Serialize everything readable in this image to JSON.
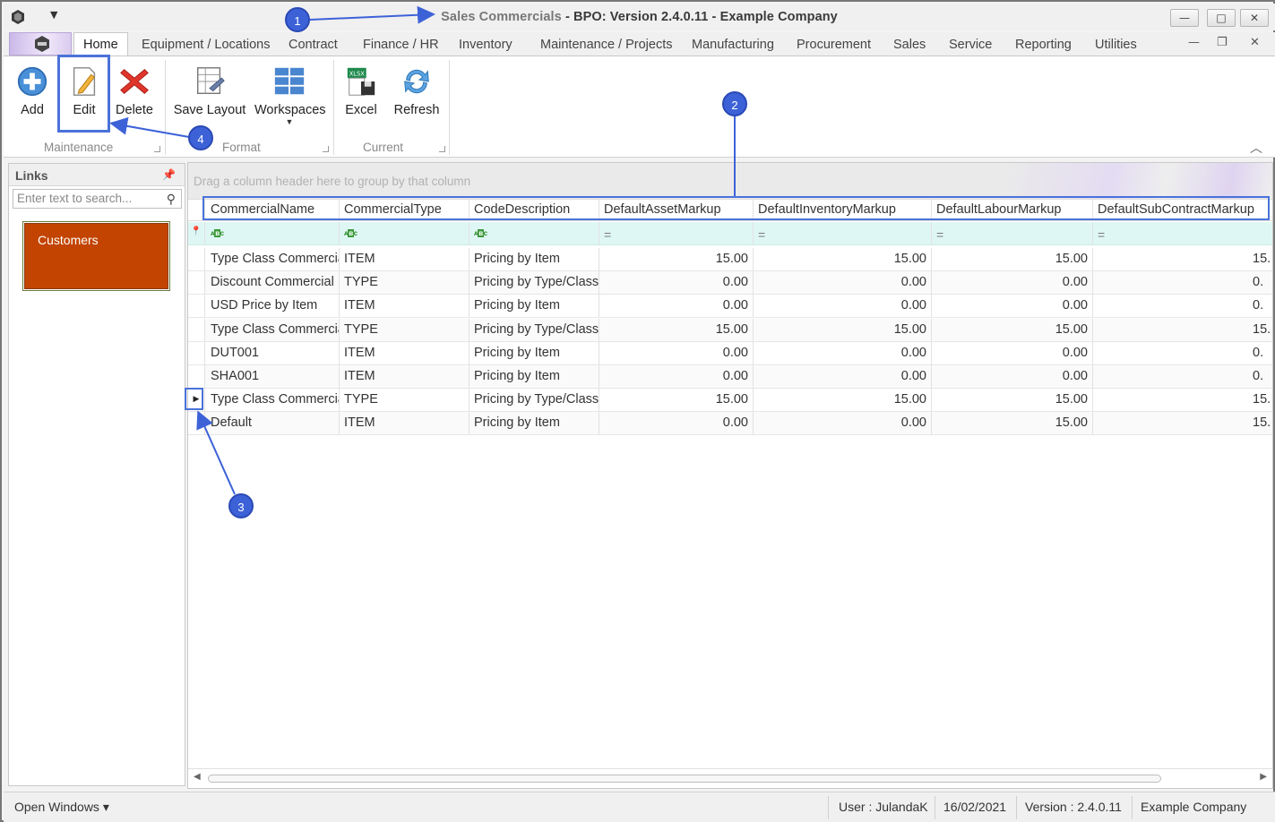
{
  "window": {
    "title_prefix": "Sales Commercials",
    "title_rest": " - BPO: Version 2.4.0.11 - Example Company",
    "min_label": "—",
    "max_label": "□",
    "close_label": "✕"
  },
  "tabs": [
    "Home",
    "Equipment / Locations",
    "Contract",
    "Finance / HR",
    "Inventory",
    "Maintenance / Projects",
    "Manufacturing",
    "Procurement",
    "Sales",
    "Service",
    "Reporting",
    "Utilities"
  ],
  "ribbon": {
    "add": "Add",
    "edit": "Edit",
    "delete": "Delete",
    "save_layout": "Save Layout",
    "workspaces": "Workspaces",
    "excel": "Excel",
    "excel_badge": "XLSX",
    "refresh": "Refresh",
    "group_maintenance": "Maintenance",
    "group_format": "Format",
    "group_current": "Current"
  },
  "links": {
    "title": "Links",
    "search_placeholder": "Enter text to search...",
    "tile": "Customers"
  },
  "grid": {
    "group_hint": "Drag a column header here to group by that column",
    "columns": [
      "CommercialName",
      "CommercialType",
      "CodeDescription",
      "DefaultAssetMarkup",
      "DefaultInventoryMarkup",
      "DefaultLabourMarkup",
      "DefaultSubContractMarkup"
    ],
    "rows": [
      [
        "Type Class Commercial",
        "ITEM",
        "Pricing by Item",
        "15.00",
        "15.00",
        "15.00",
        "15."
      ],
      [
        "Discount Commercial",
        "TYPE",
        "Pricing by Type/Class",
        "0.00",
        "0.00",
        "0.00",
        "0."
      ],
      [
        "USD Price by Item",
        "ITEM",
        "Pricing by Item",
        "0.00",
        "0.00",
        "0.00",
        "0."
      ],
      [
        "Type Class Commercial",
        "TYPE",
        "Pricing by Type/Class",
        "15.00",
        "15.00",
        "15.00",
        "15."
      ],
      [
        "DUT001",
        "ITEM",
        "Pricing by Item",
        "0.00",
        "0.00",
        "0.00",
        "0."
      ],
      [
        "SHA001",
        "ITEM",
        "Pricing by Item",
        "0.00",
        "0.00",
        "0.00",
        "0."
      ],
      [
        "Type Class Commercial",
        "TYPE",
        "Pricing by Type/Class",
        "15.00",
        "15.00",
        "15.00",
        "15."
      ],
      [
        "Default",
        "ITEM",
        "Pricing by Item",
        "0.00",
        "0.00",
        "15.00",
        "15."
      ]
    ],
    "selected_row": 6
  },
  "status": {
    "open_windows": "Open Windows ▾",
    "user": "User : JulandaK",
    "date": "16/02/2021",
    "version": "Version : 2.4.0.11",
    "company": "Example Company"
  },
  "callouts": [
    "1",
    "2",
    "3",
    "4"
  ],
  "colors": {
    "accent": "#4a72d9",
    "tile": "#c24400",
    "filter_row": "#dff7f4"
  }
}
